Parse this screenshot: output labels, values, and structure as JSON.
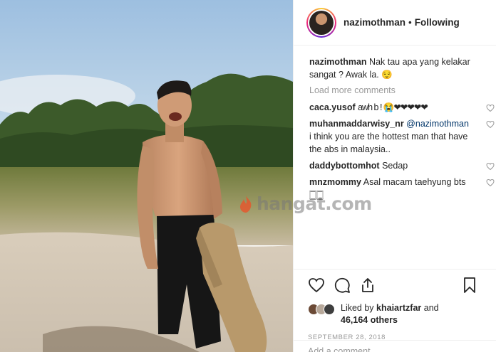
{
  "post": {
    "username": "nazimothman",
    "follow_status": "Following",
    "separator": "•",
    "caption": "Nak tau apa yang kelakar sangat ? Awak la. 😌"
  },
  "comments": {
    "load_more": "Load more comments",
    "items": [
      {
        "user": "caca.yusof",
        "text": "awh b ! 😭❤❤❤❤❤"
      },
      {
        "user": "muhanmaddarwisy_nr",
        "mention": "@nazimothman",
        "text": "i think you are the hottest man that have the abs in malaysia.."
      },
      {
        "user": "daddybottomhot",
        "text": "Sedap"
      },
      {
        "user": "mnzmommy",
        "text": "Asal macam taehyung bts",
        "extra": "🀆🀆"
      }
    ]
  },
  "likes": {
    "prefix": "Liked by",
    "by_user": "khaiartzfar",
    "and": "and",
    "others": "46,164 others"
  },
  "date": "SEPTEMBER 28, 2018",
  "add_comment_placeholder": "Add a comment…",
  "watermark": "hangat.com",
  "icons": {
    "like": "heart-icon",
    "comment": "comment-bubble-icon",
    "share": "share-icon",
    "save": "bookmark-icon"
  }
}
